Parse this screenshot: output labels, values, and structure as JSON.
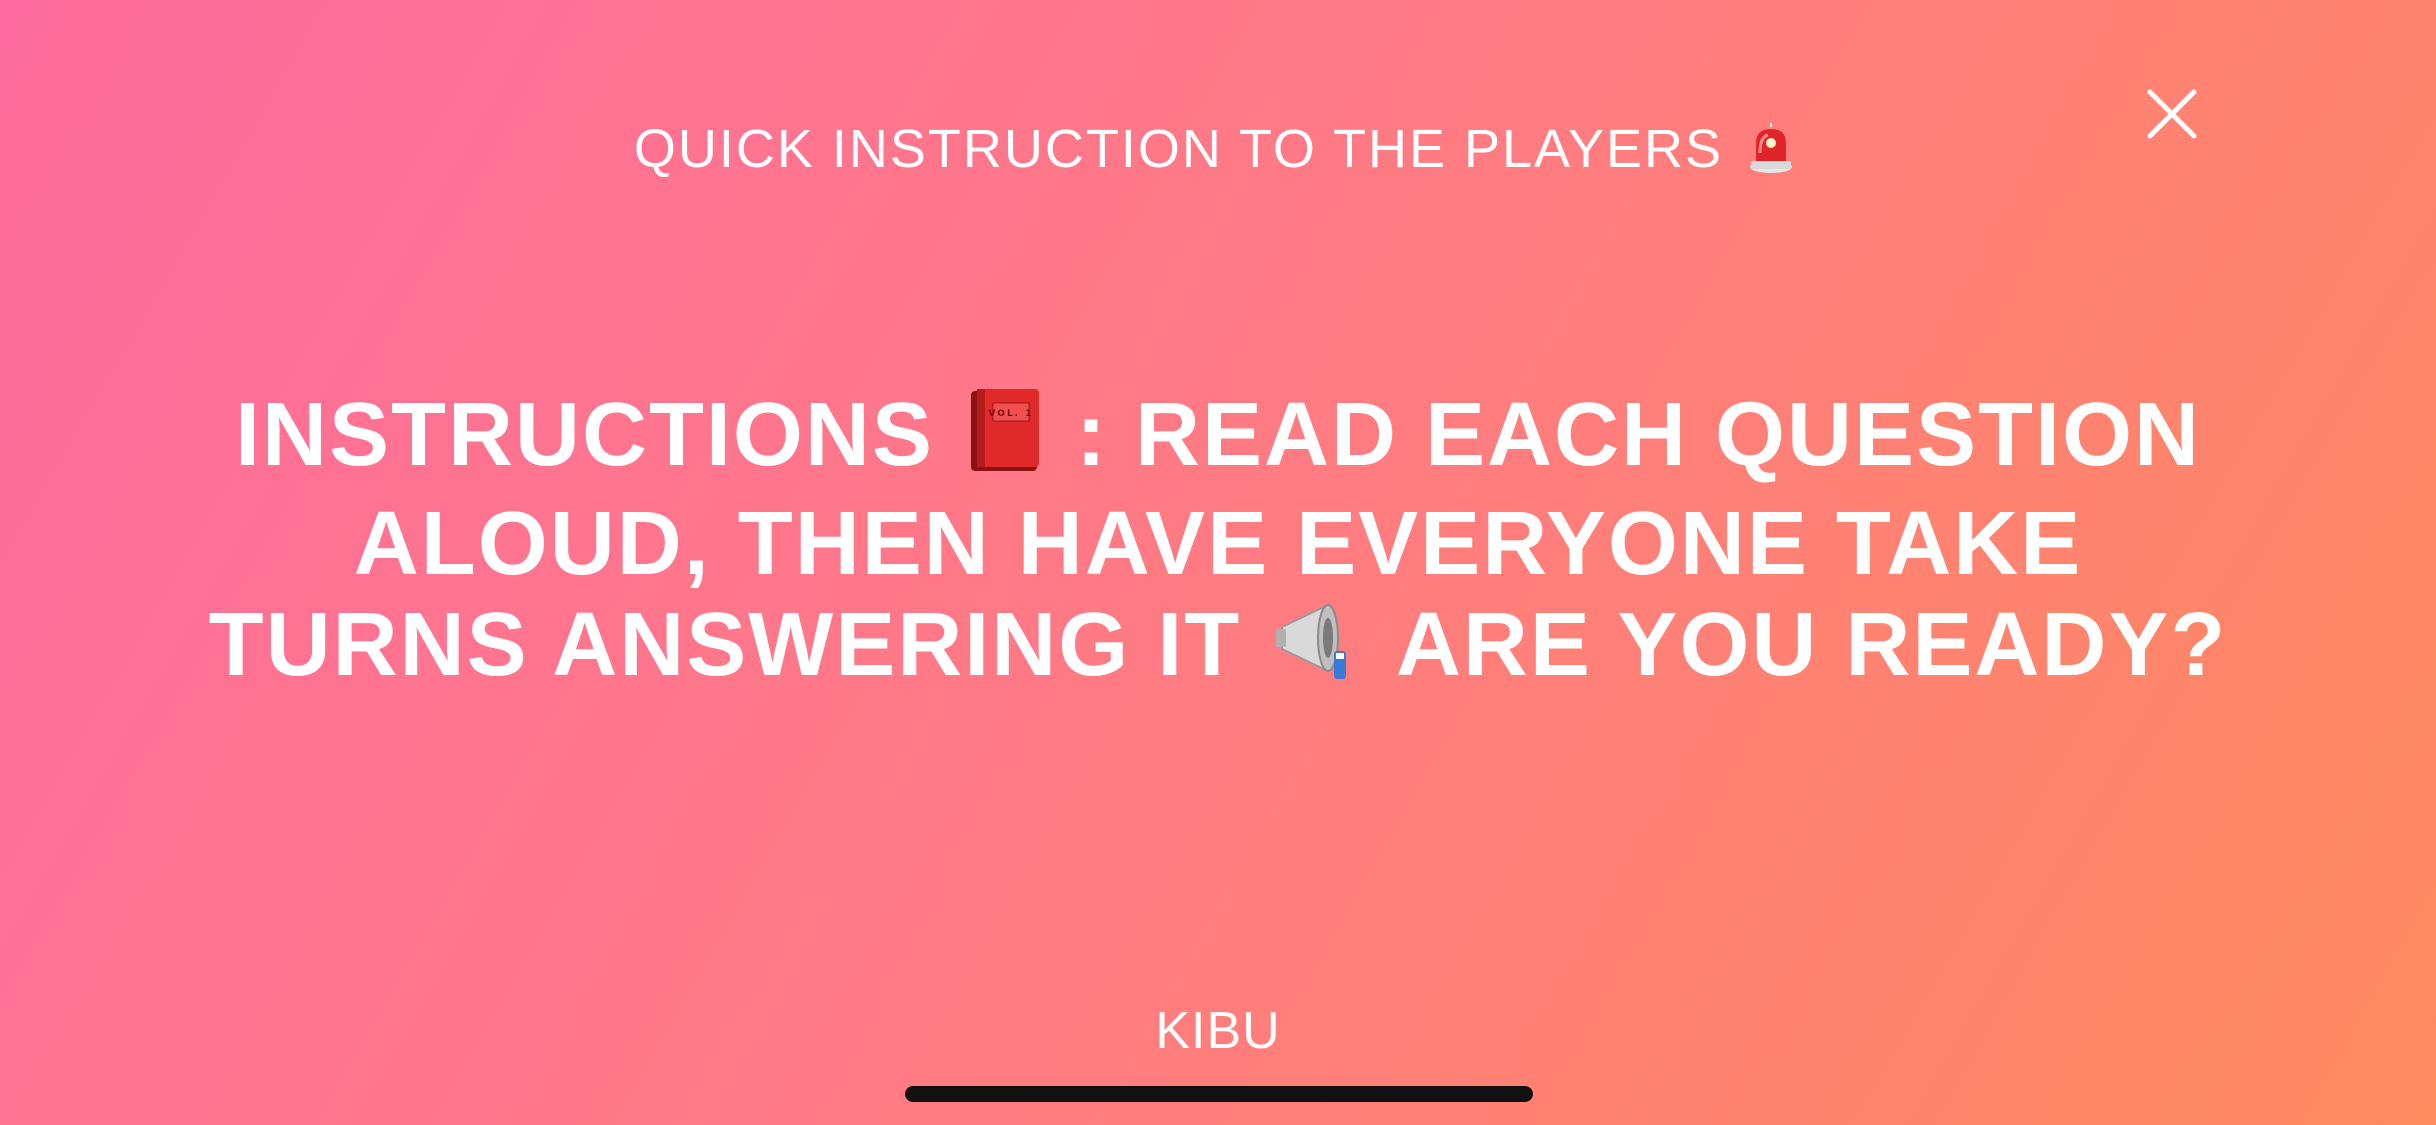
{
  "header": {
    "title": "QUICK INSTRUCTION TO THE PLAYERS",
    "title_icon": "siren-icon"
  },
  "close": {
    "icon": "close-icon"
  },
  "instructions": {
    "part1": "INSTRUCTIONS",
    "book_icon": "red-book-icon",
    "book_label": "VOL. 1",
    "part2": ": READ EACH QUESTION ALOUD, THEN HAVE EVERYONE TAKE TURNS ANSWERING IT",
    "megaphone_icon": "megaphone-icon",
    "part3": "ARE YOU READY?"
  },
  "footer": {
    "label": "KIBU"
  },
  "colors": {
    "gradient_start": "#ff6b9e",
    "gradient_end": "#ff8a5e",
    "text": "#ffffff"
  }
}
